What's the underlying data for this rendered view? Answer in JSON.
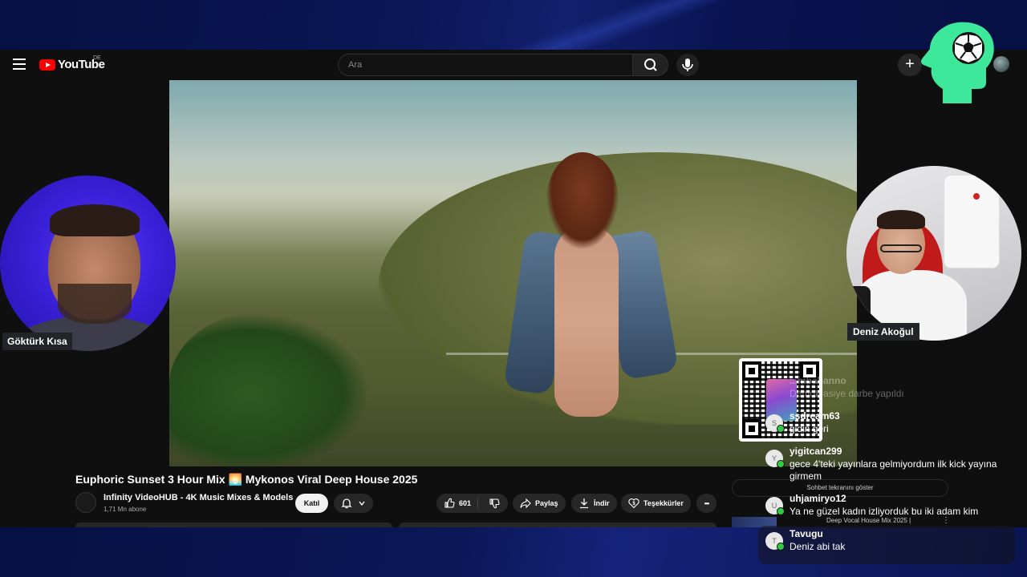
{
  "youtube": {
    "logo_text": "YouTube",
    "region": "DE",
    "search_placeholder": "Ara",
    "create_symbol": "+"
  },
  "video": {
    "title": "Euphoric Sunset 3 Hour Mix 🌅 Mykonos Viral Deep House 2025",
    "channel_name": "Infinity VideoHUB - 4K Music Mixes & Models",
    "subscribers": "1,71 Mn abone",
    "join_label": "Katıl",
    "like_count": "601",
    "share_label": "Paylaş",
    "download_label": "İndir",
    "thanks_label": "Teşekkürler",
    "more_symbol": "•••"
  },
  "sidebar": {
    "show_chat_label": "Sohbet tekranını göster",
    "next_video_title": "Deep Vocal House Mix 2025 |",
    "more_symbol": "⋮"
  },
  "streamers": {
    "left_name": "Göktürk Kısa",
    "right_name": "Deniz Akoğul"
  },
  "chat": [
    {
      "user": "...mbabanno",
      "text": "Demokrasiye darbe yapıldı",
      "avatar": "",
      "faded": true
    },
    {
      "user": "ssdream63",
      "text": "gidin geri",
      "avatar": "S"
    },
    {
      "user": "yigitcan299",
      "text": "gece 4'teki yayınlara gelmiyordum ilk kick yayına girmem",
      "avatar": "Y"
    },
    {
      "user": "uhjamiryo12",
      "text": "Ya ne güzel kadın izliyorduk bu iki adam kim",
      "avatar": "U"
    },
    {
      "user": "Tavugu",
      "text": "Deniz abi tak",
      "avatar": "T"
    }
  ],
  "colors": {
    "frame": "#0b1446",
    "youtube_bg": "#0f0f0f",
    "brain_logo": "#3de89a",
    "chat_badge": "#2ecc40"
  },
  "icons": [
    "menu-icon",
    "search-icon",
    "mic-icon",
    "plus-icon",
    "bell-icon",
    "chevron-down-icon",
    "thumbs-up-icon",
    "thumbs-down-icon",
    "share-icon",
    "download-icon",
    "thanks-icon",
    "more-icon",
    "brain-soccer-logo"
  ]
}
